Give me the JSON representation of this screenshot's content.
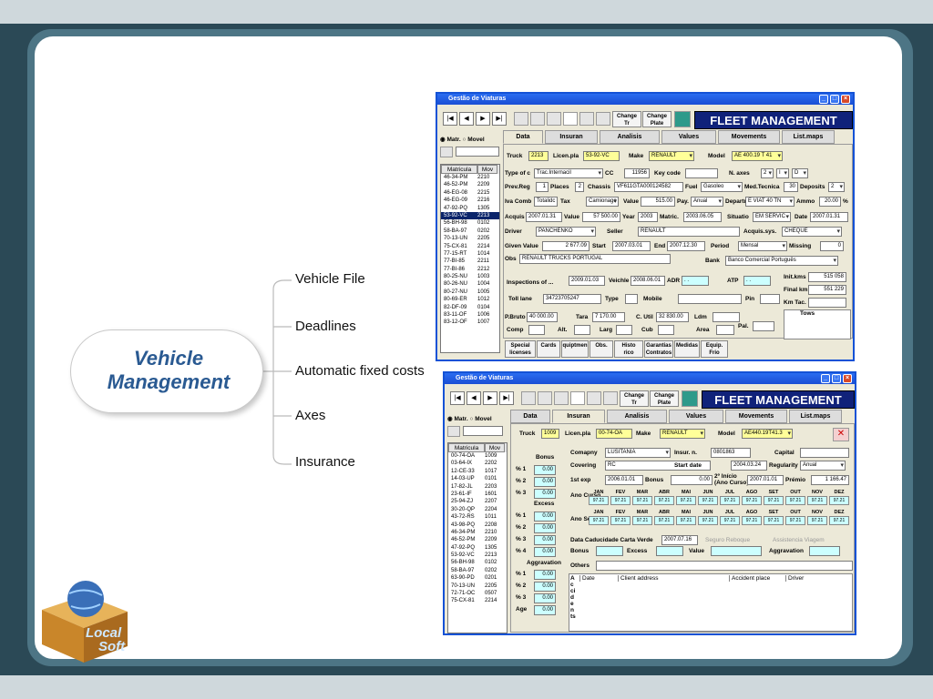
{
  "slide": {
    "title": "Vehicle Management",
    "center_line1": "Vehicle",
    "center_line2": "Management"
  },
  "branches": [
    "Vehicle File",
    "Deadlines",
    "Automatic fixed costs",
    "Axes",
    "Insurance"
  ],
  "logo": {
    "line1": "Local",
    "line2": "Soft"
  },
  "colors": {
    "slide_bg": "#2b4956",
    "frame": "#4d7585",
    "fleet_banner": "#10227a",
    "titlebar": "#1a4ed4",
    "yellow": "#ffff99",
    "cyan": "#ccffff"
  },
  "app": {
    "window_title": "Gestão de Viaturas",
    "fleet": "FLEET MANAGEMENT",
    "change_tr": [
      "Change",
      "Tr"
    ],
    "change_plate": [
      "Change",
      "Plate"
    ],
    "radio_matr": "Matr.",
    "radio_movel": "Movel",
    "list_headers": [
      "Matricula",
      "Mov"
    ],
    "icons": [
      "first-icon",
      "prev-icon",
      "next-icon",
      "last-icon"
    ]
  },
  "w1": {
    "tabs": [
      "Data",
      "Insuran",
      "Analisis",
      "Values",
      "Movements",
      "List.maps"
    ],
    "list": [
      [
        "46-34-PM",
        "2210"
      ],
      [
        "46-52-PM",
        "2209"
      ],
      [
        "46-EG-08",
        "2215"
      ],
      [
        "46-EG-09",
        "2216"
      ],
      [
        "47-92-PQ",
        "1305"
      ],
      [
        "53-92-VC",
        "2213"
      ],
      [
        "56-BH-98",
        "0102"
      ],
      [
        "58-BA-97",
        "0202"
      ],
      [
        "70-13-UN",
        "2205"
      ],
      [
        "75-CX-81",
        "2214"
      ],
      [
        "77-15-RT",
        "1014"
      ],
      [
        "77-BI-85",
        "2211"
      ],
      [
        "77-BI-86",
        "2212"
      ],
      [
        "80-25-NU",
        "1003"
      ],
      [
        "80-26-NU",
        "1004"
      ],
      [
        "80-27-NU",
        "1005"
      ],
      [
        "80-69-ER",
        "1012"
      ],
      [
        "82-DF-09",
        "0104"
      ],
      [
        "83-11-OF",
        "1006"
      ],
      [
        "83-12-OF",
        "1007"
      ]
    ],
    "labels": {
      "truck": "Truck",
      "licen": "Licen.pla",
      "make": "Make",
      "model": "Model",
      "type": "Type of c",
      "cc": "CC",
      "keycode": "Key code",
      "naxes": "N. axes",
      "prevreg": "Prev.Reg",
      "places": "Places",
      "chassis": "Chassis",
      "fuel": "Fuel",
      "medtec": "Med.Tecnica",
      "deposits": "Deposits",
      "iva": "Iva Comb",
      "tax": "Tax",
      "value": "Value",
      "pay": "Pay.",
      "depart": "Departr",
      "ammo": "Ammo",
      "acquis": "Acquis",
      "valuea": "Value",
      "year": "Year",
      "matric": "Matric.",
      "situatio": "Situatio",
      "date": "Date",
      "driver": "Driver",
      "seller": "Seller",
      "acqsys": "Acquis.sys.",
      "given": "Given Value",
      "start": "Start",
      "end": "End",
      "period": "Period",
      "missing": "Missing",
      "obs": "Obs",
      "bank": "Bank",
      "inspec": "Inspections of ...",
      "veichle": "Veichle",
      "adr": "ADR",
      "atp": "ATP",
      "initkms": "Init.kms",
      "finalkm": "Final km",
      "kmtac": "Km Tac.",
      "toll": "Toll lane",
      "type2": "Type",
      "mobile": "Mobile",
      "pin": "Pin",
      "tows": "Tows",
      "pbruto": "P.Bruto",
      "tara": "Tara",
      "cutil": "C. Util",
      "ldm": "Ldm",
      "comp": "Comp",
      "alt": "Alt.",
      "larg": "Larg",
      "cub": "Cub",
      "area": "Area",
      "pal": "Pal."
    },
    "values": {
      "truck": "2213",
      "licen": "53-92-VC",
      "make": "RENAULT",
      "model": "AE 400.19 T 41",
      "type": "Trac.Internacil",
      "cc": "11956",
      "naxes": "2",
      "axes_b": "I",
      "axes_c": "D",
      "prevreg": "1",
      "places": "2",
      "chassis": "VF611GTA000124582",
      "fuel": "Gasoleo",
      "medtec": "30",
      "deposits": "2",
      "iva": "Totalidc",
      "tax": "Camionage",
      "value": "515.00",
      "pay": "Anual",
      "depart": "E VIAT 40 TN",
      "ammo": "20.00",
      "ammo_unit": "%",
      "acquis": "2007.01.31",
      "valuea": "57 500.00",
      "year": "2003",
      "matric": "2003.06.05",
      "situatio": "EM SERVIC",
      "date": "2007.01.31",
      "driver": "PANCHENKO",
      "seller": "RENAULT",
      "acqsys": "CHEQUE",
      "given": "2 677.09",
      "start": "2007.03.01",
      "end": "2007.12.30",
      "period": "Mensal",
      "missing": "0",
      "obs": "RENAULT TRUCKS PORTUGAL",
      "bank": "Banco Comercial Português",
      "inspec": "2009.01.03",
      "veichle": "2008.06.01",
      "adr": ". .",
      "atp": ". .",
      "initkms": "515 058",
      "finalkm": "551 229",
      "toll": "34723705247",
      "pbruto": "40 000.00",
      "tara": "7 170.00",
      "cutil": "32 830.00"
    },
    "buttons": [
      [
        "Special",
        "licenses"
      ],
      [
        "Cards",
        ""
      ],
      [
        "quiptmen",
        ""
      ],
      [
        "Obs.",
        ""
      ],
      [
        "Histo",
        "rico"
      ],
      [
        "Garantias",
        "Contratos"
      ],
      [
        "Medidas",
        ""
      ],
      [
        "Equip.",
        "Frio"
      ]
    ]
  },
  "w2": {
    "tabs": [
      "Data",
      "Insuran",
      "Analisis",
      "Values",
      "Movements",
      "List.maps"
    ],
    "list": [
      [
        "00-74-OA",
        "1009"
      ],
      [
        "03-64-IX",
        "2202"
      ],
      [
        "12-CE-33",
        "1017"
      ],
      [
        "14-03-UP",
        "0101"
      ],
      [
        "17-82-JL",
        "2203"
      ],
      [
        "23-61-IF",
        "1601"
      ],
      [
        "25-94-ZJ",
        "2207"
      ],
      [
        "30-20-QP",
        "2204"
      ],
      [
        "43-72-RS",
        "1011"
      ],
      [
        "43-98-PQ",
        "2208"
      ],
      [
        "46-34-PM",
        "2210"
      ],
      [
        "46-52-PM",
        "2209"
      ],
      [
        "47-92-PQ",
        "1305"
      ],
      [
        "53-92-VC",
        "2213"
      ],
      [
        "56-BH-98",
        "0102"
      ],
      [
        "58-BA-97",
        "0202"
      ],
      [
        "63-90-PD",
        "0201"
      ],
      [
        "70-13-UN",
        "2205"
      ],
      [
        "72-71-OC",
        "0507"
      ],
      [
        "75-CX-81",
        "2214"
      ]
    ],
    "truck": "1009",
    "licen": "00-74-OA",
    "make": "RENAULT",
    "model": "AE440.19T41.3",
    "bonus_title": "Bonus",
    "excess_title": "Excess",
    "aggr_title": "Aggravation",
    "pct1": "% 1",
    "pct2": "% 2",
    "pct3": "% 3",
    "pct4": "% 4",
    "age": "Age",
    "zero": "0.00",
    "labels": {
      "company": "Comapny",
      "insur": "Insur. n.",
      "capital": "Capital",
      "covering": "Covering",
      "startdate": "Start date",
      "regularity": "Regularity",
      "firstexp": "1st exp",
      "bonus": "Bonus",
      "inicio": "2º Início",
      "anocurso": "(Ano Curso)",
      "premio": "Prémio",
      "anocurso2": "Ano Curso",
      "anoseg": "Ano Seg.",
      "cartaverde": "Data Caducidade Carta Verde",
      "reboque": "Seguro Reboque",
      "assistencia": "Assistencia Viagem",
      "bonus2": "Bonus",
      "excess": "Excess",
      "value": "Value",
      "aggravation": "Aggravation",
      "others": "Others",
      "accidents": "Accidents"
    },
    "values": {
      "company": "LUSITANIA",
      "insur": "0801863",
      "covering": "RC",
      "startdate": "2004.03.24",
      "regularity": "Anual",
      "firstexp": "2006.01.01",
      "bonus": "0.00",
      "inicio": "2007.01.01",
      "premio": "1 166.47",
      "cartaverde": "2007.07.16"
    },
    "months": [
      "JAN",
      "FEV",
      "MAR",
      "ABR",
      "MAI",
      "JUN",
      "JUL",
      "AGO",
      "SET",
      "OUT",
      "NOV",
      "DEZ"
    ],
    "month_val": "97.21",
    "acc_headers": [
      "Date",
      "Client address",
      "Accident place",
      "Driver"
    ]
  }
}
